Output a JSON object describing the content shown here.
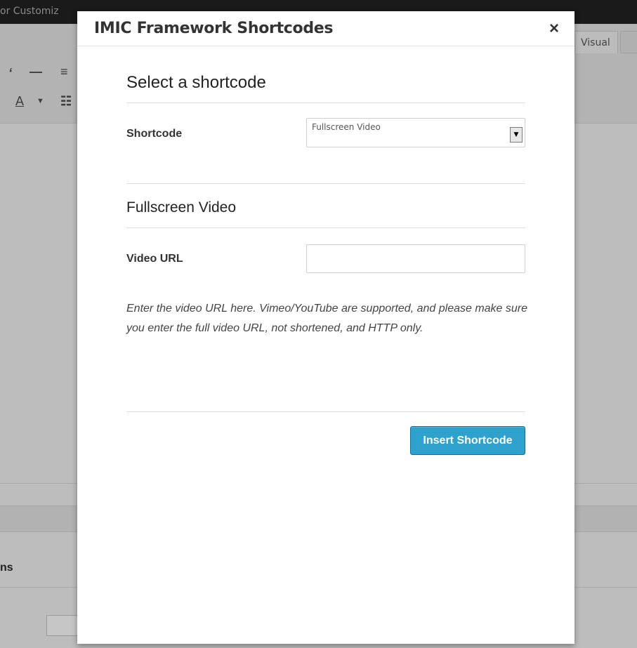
{
  "background": {
    "adminbar_text": "or Customiz",
    "visual_tab_label": "Visual",
    "section_fragment": "ns",
    "toolbar_icons": [
      "italic-icon",
      "horizontal-line-icon",
      "align-icon",
      "text-color-icon",
      "dropdown-icon",
      "paste-text-icon"
    ]
  },
  "modal": {
    "title": "IMIC Framework Shortcodes",
    "close_symbol": "×",
    "select_heading": "Select a shortcode",
    "shortcode_label": "Shortcode",
    "shortcode_selected": "Fullscreen Video",
    "options_heading": "Fullscreen Video",
    "video_url_label": "Video URL",
    "video_url_value": "",
    "help_text": "Enter the video URL here. Vimeo/YouTube are supported, and please make sure you enter the full video URL, not shortened, and HTTP only.",
    "insert_button": "Insert Shortcode"
  },
  "colors": {
    "primary_button": "#2ea2cc",
    "primary_button_border": "#0074a2",
    "adminbar": "#1a1a1a"
  }
}
